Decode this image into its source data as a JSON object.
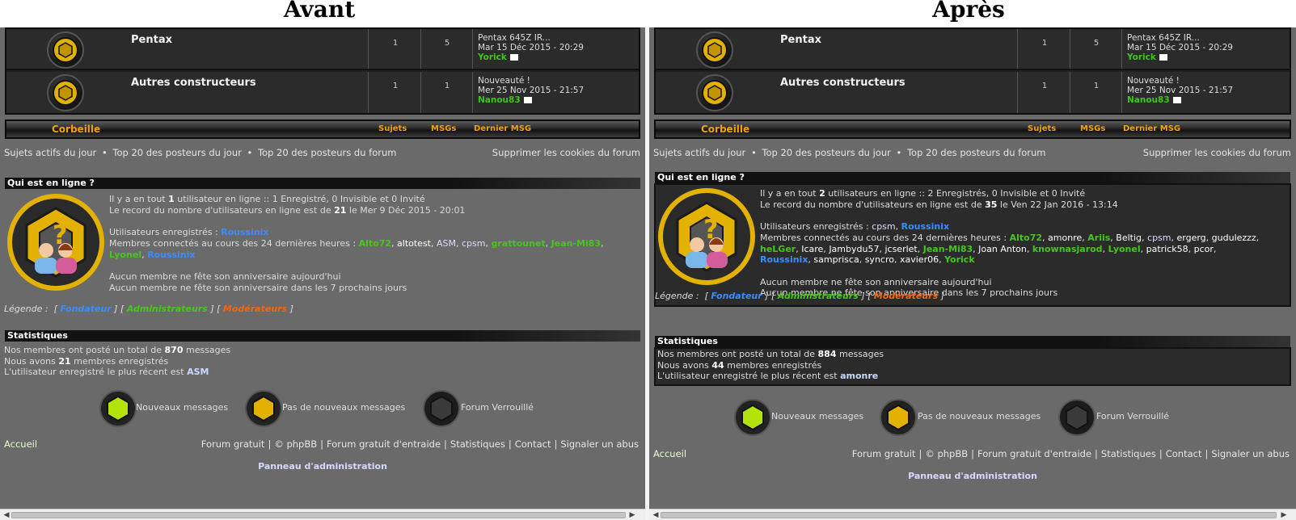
{
  "headings": {
    "left": "Avant",
    "right": "Après"
  },
  "colors": {
    "founder": "#3c8dff",
    "admin": "#48c61e",
    "moderator": "#f06812",
    "accent": "#f0a400",
    "icon_gold": "#e3b200",
    "icon_new": "#b4e30b"
  },
  "forums": [
    {
      "title": "Pentax",
      "topics": "1",
      "messages": "5",
      "last_title": "Pentax 645Z IR...",
      "last_date": "Mar 15 Déc 2015 - 20:29",
      "last_user": "Yorick"
    },
    {
      "title": "Autres constructeurs",
      "topics": "1",
      "messages": "1",
      "last_title": "Nouveauté !",
      "last_date": "Mer 25 Nov 2015 - 21:57",
      "last_user": "Nanou83"
    }
  ],
  "corbeille": {
    "title": "Corbeille",
    "col_topics": "Sujets",
    "col_msgs": "MSGs",
    "col_last": "Dernier MSG"
  },
  "links": {
    "active": "Sujets actifs du jour",
    "top_day": "Top 20 des posteurs du jour",
    "top_forum": "Top 20 des posteurs du forum",
    "cookies": "Supprimer les cookies du forum",
    "bullet": "•"
  },
  "who": {
    "title": "Qui est en ligne ?",
    "before": {
      "line1a": "Il y a en tout ",
      "line1n": "1",
      "line1b": " utilisateur en ligne :: 1 Enregistré, 0 Invisible et 0 Invité",
      "line2a": "Le record du nombre d'utilisateurs en ligne est de ",
      "line2n": "21",
      "line2b": " le Mer 9 Déc 2015 - 20:01",
      "registered_label": "Utilisateurs enregistrés : ",
      "members_label": "Membres connectés au cours des 24 dernières heures : ",
      "birthday1": "Aucun membre ne fête son anniversaire aujourd'hui",
      "birthday2": "Aucun membre ne fête son anniversaire dans les 7 prochains jours"
    },
    "after": {
      "line1a": "Il y a en tout ",
      "line1n": "2",
      "line1b": " utilisateurs en ligne :: 2 Enregistrés, 0 Invisible et 0 Invité",
      "line2a": "Le record du nombre d'utilisateurs en ligne est de ",
      "line2n": "35",
      "line2b": " le Ven 22 Jan 2016 - 13:14",
      "registered_label": "Utilisateurs enregistrés : ",
      "members_label": "Membres connectés au cours des 24 dernières heures : ",
      "birthday1": "Aucun membre ne fête son anniversaire aujourd'hui",
      "birthday2": "Aucun membre ne fête son anniversaire dans les 7 prochains jours"
    }
  },
  "legend": {
    "label": "Légende :",
    "founder": "Fondateur",
    "admins": "Administrateurs",
    "mods": "Modérateurs"
  },
  "stats": {
    "title": "Statistiques",
    "before": {
      "l1a": "Nos membres ont posté un total de ",
      "l1n": "870",
      "l1b": " messages",
      "l2a": "Nous avons ",
      "l2n": "21",
      "l2b": " membres enregistrés",
      "l3a": "L'utilisateur enregistré le plus récent est ",
      "l3n": "ASM"
    },
    "after": {
      "l1a": "Nos membres ont posté un total de ",
      "l1n": "884",
      "l1b": " messages",
      "l2a": "Nous avons ",
      "l2n": "44",
      "l2b": " membres enregistrés",
      "l3a": "L'utilisateur enregistré le plus récent est ",
      "l3n": "amonre"
    }
  },
  "status_icons": {
    "new": "Nouveaux messages",
    "none": "Pas de nouveaux messages",
    "locked": "Forum Verrouillé"
  },
  "footer": {
    "home": "Accueil",
    "forum_gratuit": "Forum gratuit",
    "phpbb": "© phpBB",
    "entraide": "Forum gratuit d'entraide",
    "stats": "Statistiques",
    "contact": "Contact",
    "abuse": "Signaler un abus",
    "sep": "|",
    "admin_panel": "Panneau d'administration"
  },
  "scroll": {
    "left_arrow": "◀",
    "right_arrow": "▶"
  }
}
